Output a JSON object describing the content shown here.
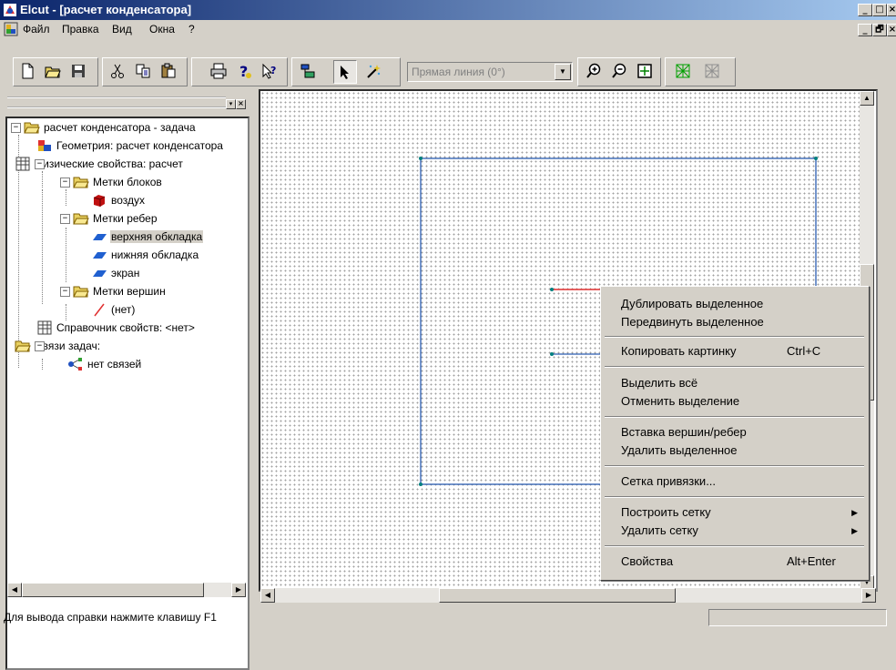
{
  "window": {
    "title": "Elcut - [расчет конденсатора]",
    "controls": [
      "_",
      "□",
      "×"
    ],
    "mdi_controls": [
      "_",
      "🗗",
      "×"
    ]
  },
  "menubar": {
    "items": [
      "Файл",
      "Правка",
      "Вид",
      "Окна",
      "?"
    ]
  },
  "toolbar": {
    "buttons": [
      "new-file-icon",
      "open-folder-icon",
      "save-icon",
      "cut-icon",
      "copy-icon",
      "paste-icon",
      "print-icon",
      "help-icon",
      "context-help-icon",
      "layout-icon",
      "select-arrow-icon",
      "magic-wand-icon",
      "zoom-in-icon",
      "zoom-out-icon",
      "zoom-fit-icon",
      "mesh-build-icon",
      "mesh-delete-icon"
    ],
    "line_combo_value": "Прямая линия (0°)"
  },
  "tree": {
    "root": "расчет конденсатора - задача",
    "geometry": "Геометрия: расчет конденсатора",
    "physics": "Физические свойства: расчет",
    "block_labels": "Метки блоков",
    "block_air": "воздух",
    "edge_labels": "Метки ребер",
    "edge_top": "верхняя обкладка",
    "edge_bottom": "нижняя обкладка",
    "edge_screen": "экран",
    "vertex_labels": "Метки вершин",
    "vertex_none": "(нет)",
    "reference": "Справочник свойств: <нет>",
    "links": "Связи задач:",
    "no_links": "нет связей"
  },
  "context_menu": {
    "duplicate": "Дублировать выделенное",
    "move": "Передвинуть выделенное",
    "copy_picture": "Копировать картинку",
    "copy_picture_shortcut": "Ctrl+C",
    "select_all": "Выделить всё",
    "deselect": "Отменить выделение",
    "insert_vertices": "Вставка вершин/ребер",
    "delete_selected": "Удалить выделенное",
    "snap_grid": "Сетка привязки...",
    "build_mesh": "Построить сетку",
    "delete_mesh": "Удалить сетку",
    "properties": "Свойства",
    "properties_shortcut": "Alt+Enter"
  },
  "statusbar": {
    "text": "Для вывода справки нажмите клавишу F1"
  },
  "colors": {
    "title_start": "#0a246a",
    "title_end": "#a6caf0",
    "geometry_blue": "#2a5cb0",
    "edge_red": "#e03030",
    "vertex_teal": "#008080"
  }
}
